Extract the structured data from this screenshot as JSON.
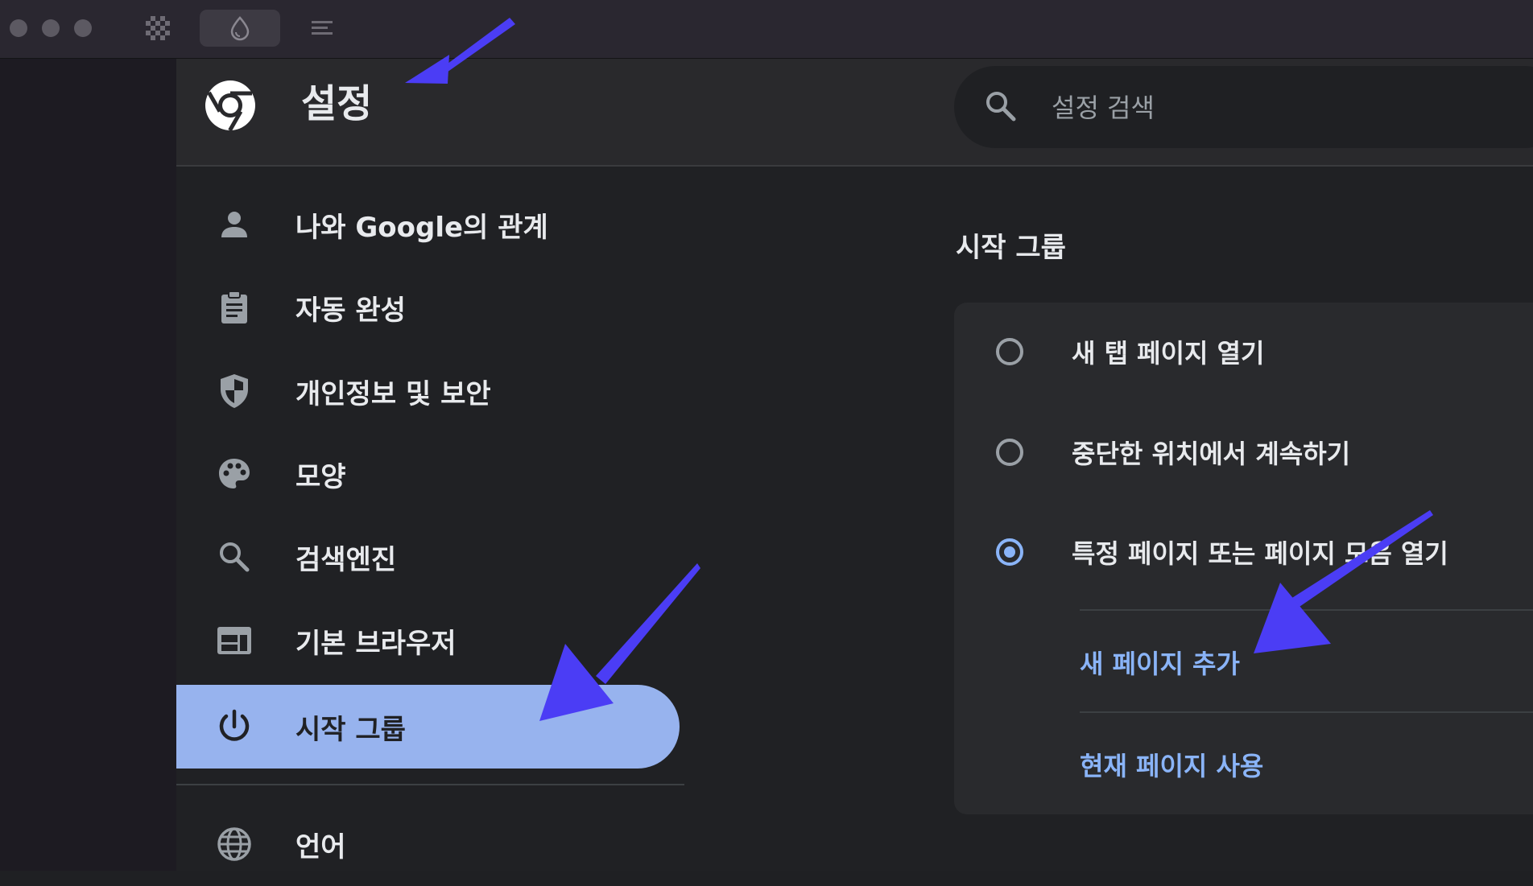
{
  "header": {
    "title": "설정",
    "search_placeholder": "설정 검색"
  },
  "sidebar": {
    "items": [
      {
        "label": "나와 Google의 관계",
        "icon": "person-icon"
      },
      {
        "label": "자동 완성",
        "icon": "clipboard-icon"
      },
      {
        "label": "개인정보 및 보안",
        "icon": "shield-icon"
      },
      {
        "label": "모양",
        "icon": "palette-icon"
      },
      {
        "label": "검색엔진",
        "icon": "search-icon"
      },
      {
        "label": "기본 브라우저",
        "icon": "browser-window-icon"
      },
      {
        "label": "시작 그룹",
        "icon": "power-icon",
        "selected": true
      },
      {
        "label": "언어",
        "icon": "globe-icon"
      }
    ]
  },
  "main": {
    "section_title": "시작 그룹",
    "options": [
      {
        "label": "새 탭 페이지 열기",
        "checked": false
      },
      {
        "label": "중단한 위치에서 계속하기",
        "checked": false
      },
      {
        "label": "특정 페이지 또는 페이지 모음 열기",
        "checked": true
      }
    ],
    "links": [
      "새 페이지 추가",
      "현재 페이지 사용"
    ]
  },
  "colors": {
    "accent": "#8ab4f8",
    "selected_nav_bg": "#97b3ee",
    "annotation_arrow": "#4b3df5"
  }
}
